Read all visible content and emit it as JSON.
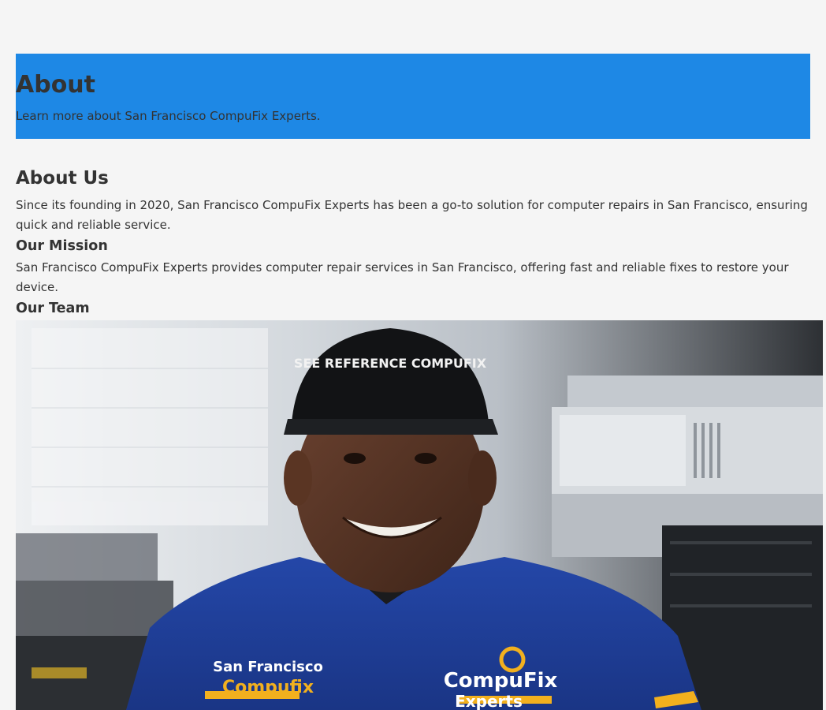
{
  "hero": {
    "title": "About",
    "subtitle": "Learn more about San Francisco CompuFix Experts."
  },
  "about_us": {
    "heading": "About Us",
    "text": "Since its founding in 2020, San Francisco CompuFix Experts has been a go-to solution for computer repairs in San Francisco, ensuring quick and reliable service."
  },
  "mission": {
    "heading": "Our Mission",
    "text": "San Francisco CompuFix Experts provides computer repair services in San Francisco, offering fast and reliable fixes to restore your device."
  },
  "team": {
    "heading": "Our Team",
    "photo": {
      "description_icon": "technician-photo",
      "cap_text": "SEE REFERENCE COMPUFIX",
      "shirt_left_line1": "San Francisco",
      "shirt_left_line2": "Compufix",
      "shirt_right_line1": "CompuFix",
      "shirt_right_line2": "Experts"
    }
  },
  "colors": {
    "hero_bg": "#1e88e5",
    "page_bg": "#f5f5f5",
    "text": "#333333",
    "shirt": "#1f3f9c",
    "shirt_accent": "#f2b01e"
  }
}
